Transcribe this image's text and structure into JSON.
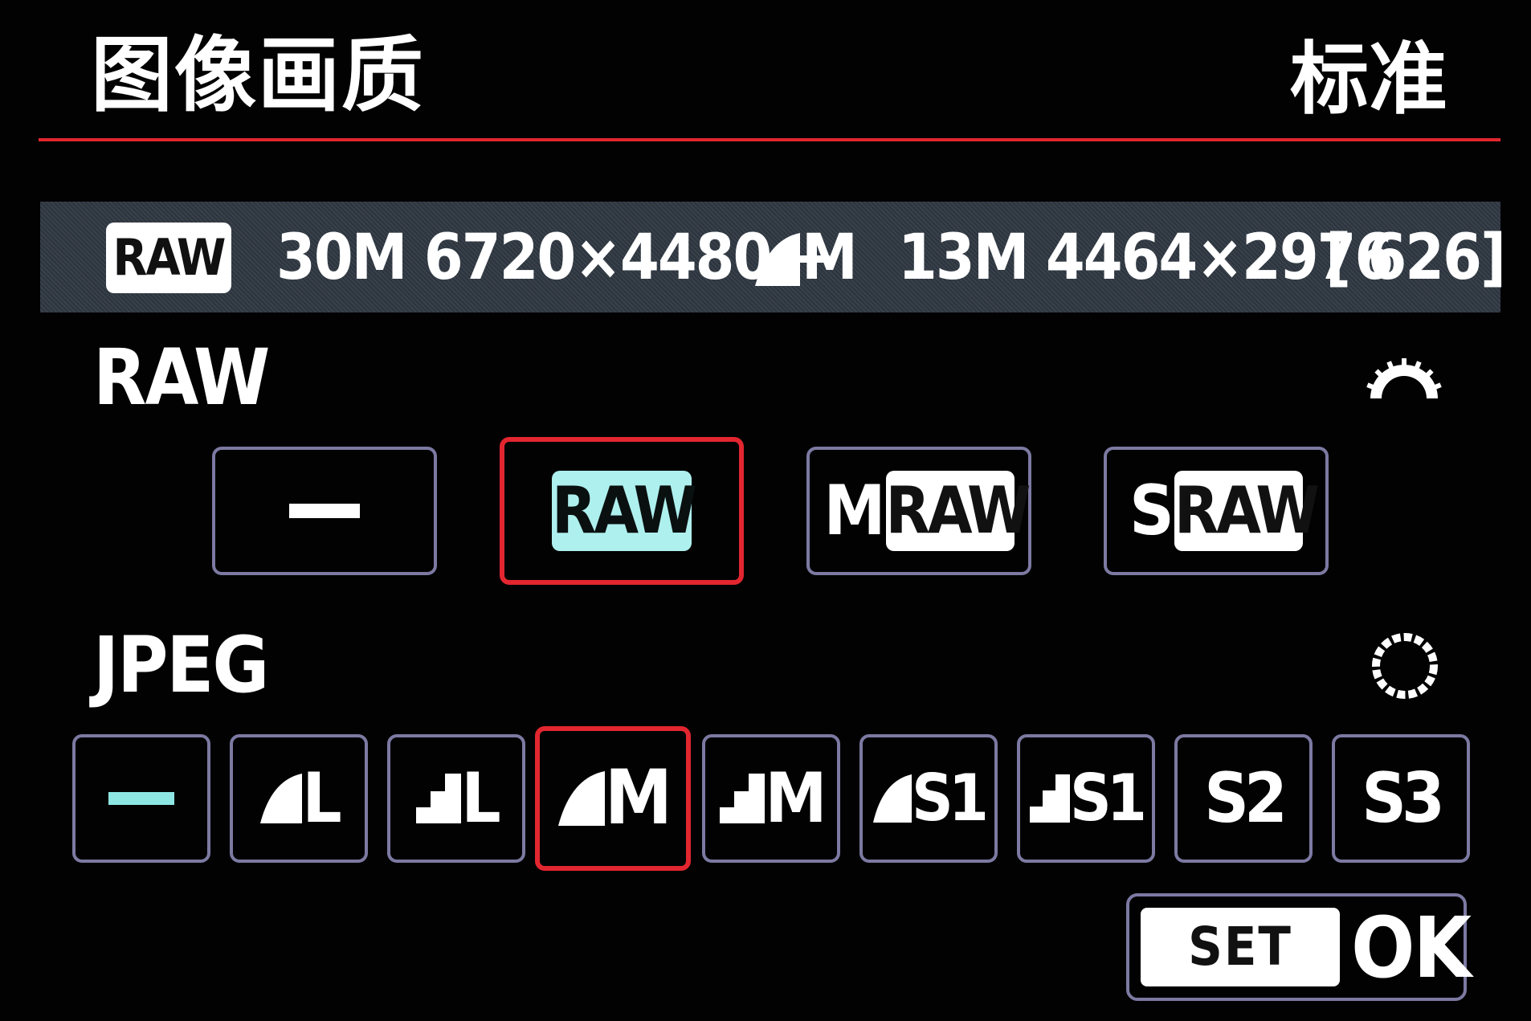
{
  "header": {
    "title": "图像画质",
    "mode": "标准"
  },
  "info_bar": {
    "raw_badge": "RAW",
    "raw_size": "30M 6720×4480 +",
    "jpeg_size_label": "M",
    "jpeg_dims": "13M 4464×2976",
    "shots_remaining": "[ 626]"
  },
  "raw_section": {
    "label": "RAW",
    "dial_icon": "main-dial-icon",
    "options": [
      {
        "id": "none",
        "label": "",
        "icon": "dash-icon"
      },
      {
        "id": "raw",
        "label": "RAW",
        "selected": true
      },
      {
        "id": "mraw",
        "prefix": "M",
        "label": "RAW"
      },
      {
        "id": "sraw",
        "prefix": "S",
        "label": "RAW"
      }
    ]
  },
  "jpeg_section": {
    "label": "JPEG",
    "dial_icon": "quick-control-dial-icon",
    "options": [
      {
        "id": "none",
        "label": "",
        "icon": "dash-icon"
      },
      {
        "id": "fine-l",
        "label": "L",
        "icon": "fine-quality-icon"
      },
      {
        "id": "normal-l",
        "label": "L",
        "icon": "normal-quality-icon"
      },
      {
        "id": "fine-m",
        "label": "M",
        "icon": "fine-quality-icon",
        "selected": true
      },
      {
        "id": "normal-m",
        "label": "M",
        "icon": "normal-quality-icon"
      },
      {
        "id": "fine-s1",
        "label": "S1",
        "icon": "fine-quality-icon"
      },
      {
        "id": "normal-s1",
        "label": "S1",
        "icon": "normal-quality-icon"
      },
      {
        "id": "s2",
        "label": "S2"
      },
      {
        "id": "s3",
        "label": "S3"
      }
    ]
  },
  "footer": {
    "set_label": "SET",
    "ok_label": "OK"
  },
  "colors": {
    "accent_red": "#e2262f",
    "box_border": "#7c7aa2",
    "selected_fill": "#aef0ee"
  }
}
